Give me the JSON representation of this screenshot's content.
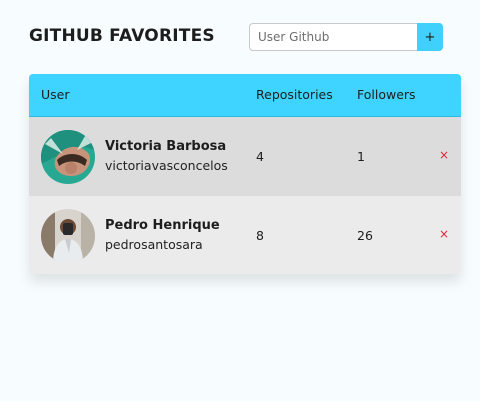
{
  "header": {
    "title": "GITHUB FAVORITES",
    "search_placeholder": "User Github",
    "add_label": "+"
  },
  "table": {
    "columns": [
      "User",
      "Repositories",
      "Followers"
    ],
    "rows": [
      {
        "name": "Victoria Barbosa",
        "login": "victoriavasconcelos",
        "repositories": "4",
        "followers": "1",
        "remove_label": "×"
      },
      {
        "name": "Pedro Henrique",
        "login": "pedrosantosara",
        "repositories": "8",
        "followers": "26",
        "remove_label": "×"
      }
    ]
  },
  "colors": {
    "accent": "#3fd4ff",
    "row_odd": "#dcdcdc",
    "row_even": "#ebebeb",
    "remove": "#e0263a",
    "background": "#f7fcfe"
  }
}
